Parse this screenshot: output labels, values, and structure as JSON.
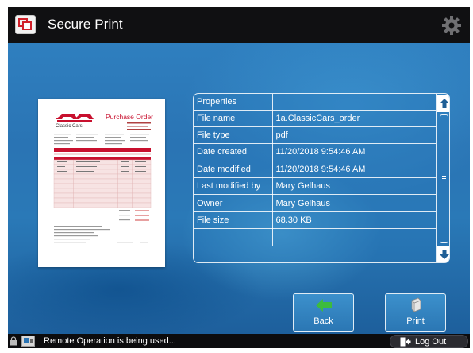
{
  "header": {
    "title": "Secure Print",
    "app_icon": "secure-print-icon",
    "settings_icon": "gear-icon"
  },
  "document_preview": {
    "brand": "Classic Cars",
    "heading": "Purchase Order",
    "accent_color": "#c8102e"
  },
  "properties": {
    "rows": [
      {
        "label": "Properties",
        "value": ""
      },
      {
        "label": "File name",
        "value": "1a.ClassicCars_order"
      },
      {
        "label": "File type",
        "value": "pdf"
      },
      {
        "label": "Date created",
        "value": "11/20/2018 9:54:46 AM"
      },
      {
        "label": "Date modified",
        "value": "11/20/2018 9:54:46 AM"
      },
      {
        "label": "Last modified by",
        "value": "Mary Gelhaus"
      },
      {
        "label": "Owner",
        "value": "Mary Gelhaus"
      },
      {
        "label": "File size",
        "value": "68.30 KB"
      },
      {
        "label": "",
        "value": ""
      }
    ]
  },
  "actions": {
    "back_label": "Back",
    "print_label": "Print"
  },
  "status_bar": {
    "message": "Remote Operation is being used...",
    "logout_label": "Log Out"
  },
  "colors": {
    "background_blue": "#2a74b4",
    "header": "#101012",
    "back_arrow": "#3dbb3d"
  }
}
